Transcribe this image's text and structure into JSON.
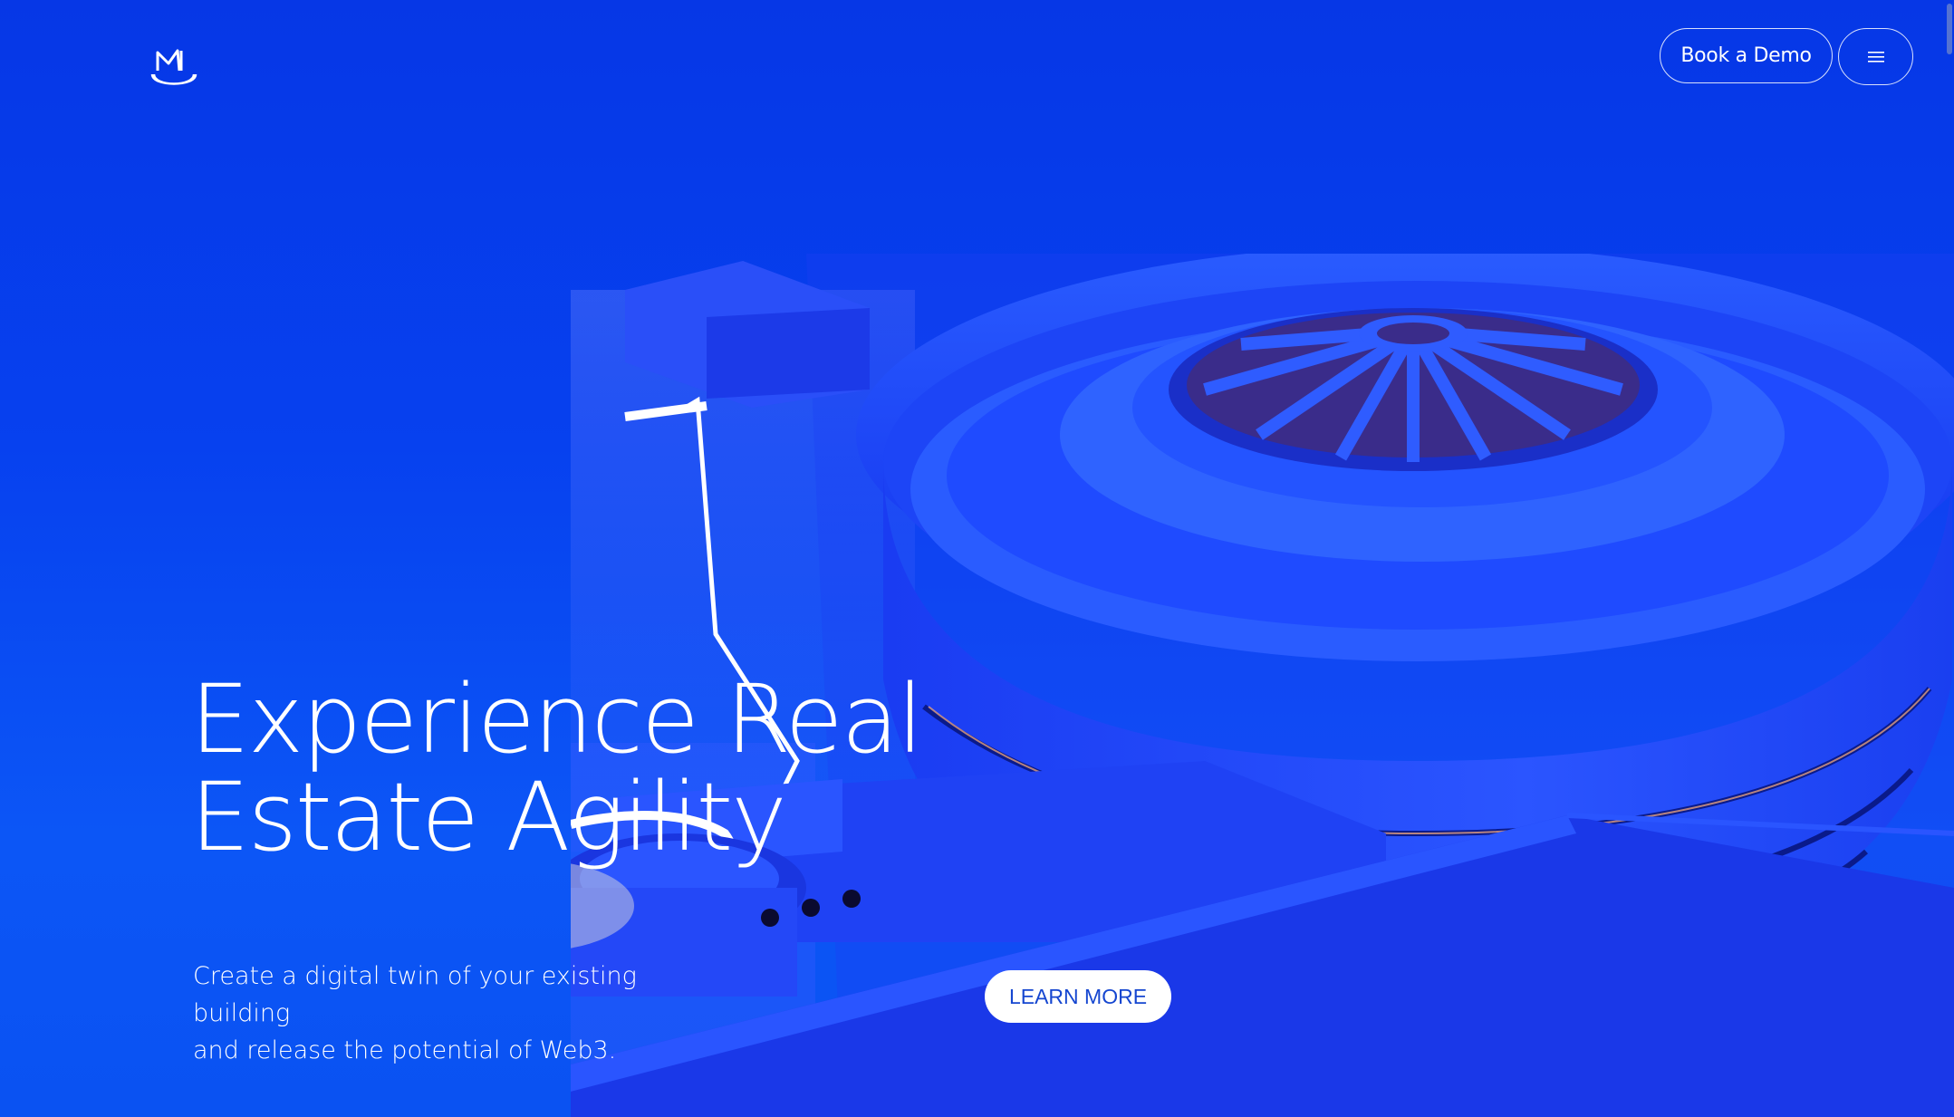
{
  "header": {
    "logo_icon": "m-logo-icon",
    "book_demo_label": "Book a Demo",
    "menu_icon": "hamburger-menu-icon"
  },
  "hero": {
    "title_line1": "Experience Real",
    "title_line2": "Estate Agility",
    "subtitle_line1": "Create a digital twin of your existing building",
    "subtitle_line2": "and release the potential of Web3.",
    "learn_more_label": "LEARN MORE",
    "illustration": "spiral-museum-building-icon"
  },
  "colors": {
    "background": "#0741ef",
    "accent": "#1546d0",
    "text": "#ffffff"
  }
}
